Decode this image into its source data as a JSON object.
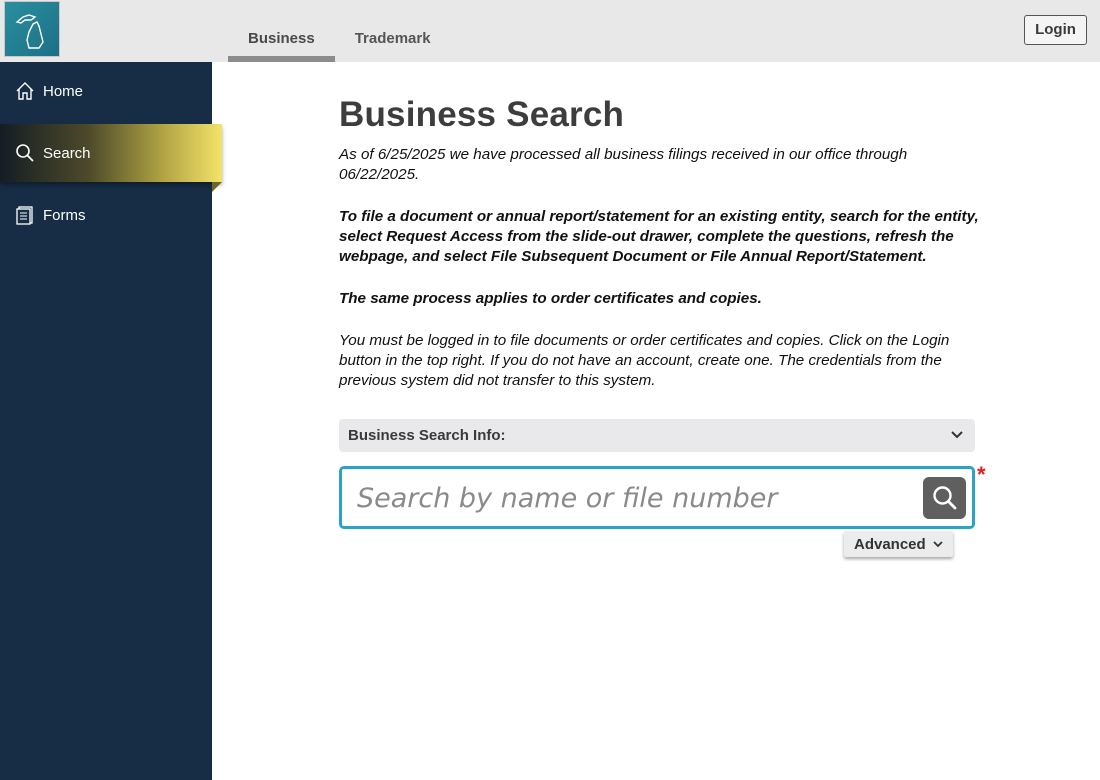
{
  "header": {
    "logo_icon": "michigan-state-logo-icon",
    "tabs": [
      {
        "label": "Business",
        "active": true
      },
      {
        "label": "Trademark",
        "active": false
      }
    ],
    "login_label": "Login"
  },
  "sidebar": {
    "items": [
      {
        "label": "Home",
        "icon": "home-icon"
      },
      {
        "label": "Search",
        "icon": "search-icon",
        "active": true
      },
      {
        "label": "Forms",
        "icon": "document-icon"
      }
    ]
  },
  "main": {
    "title": "Business Search",
    "paragraphs": [
      "As of 6/25/2025 we have processed all business filings received in our office through 06/22/2025.",
      "To file a document or annual report/statement for an existing entity, search for the entity, select Request Access from the slide-out drawer, complete the questions, refresh the webpage, and select File Subsequent Document or File Annual Report/Statement.",
      "The same process applies to order certificates and copies.",
      "You must be logged in to file documents or order certificates and copies. Click on the Login button in the top right. If you do not have an account, create one. The credentials from the previous system did not transfer to this system."
    ],
    "info_label": "Business Search Info:",
    "search": {
      "placeholder": "Search by name or file number",
      "value": "",
      "required_marker": "*"
    },
    "advanced_label": "Advanced"
  },
  "colors": {
    "sidebar_bg": "#162d45",
    "search_border": "#2ba3c8",
    "required": "#e02020",
    "search_button": "#5f5f5f"
  }
}
